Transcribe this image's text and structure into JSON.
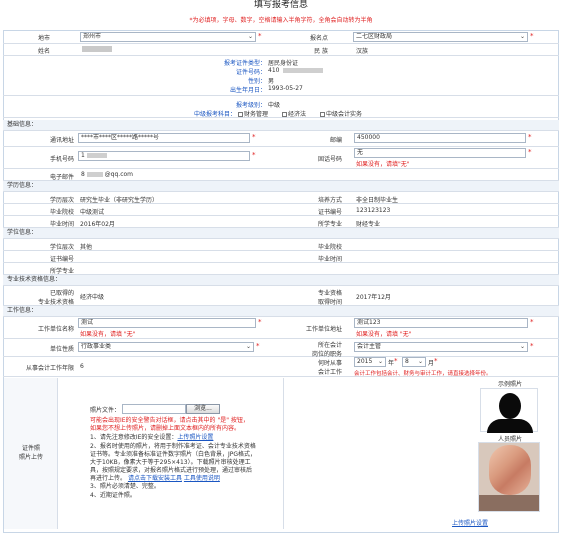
{
  "page_title": "填写报考信息",
  "notice": "*为必填项，字母、数字，空格请输入半角字符，全角会自动转为半角",
  "top": {
    "region_label": "地市",
    "region_value": "郑州市",
    "site_label": "报名点",
    "site_value": "二七区财政局",
    "name_label": "姓名",
    "nation_label": "民 族",
    "nation_value": "汉族"
  },
  "identity": {
    "idtype_label": "报考证件类型：",
    "idtype_value": "居民身份证",
    "idno_label": "证件号码：",
    "idno_value": "410",
    "gender_label": "性别：",
    "gender_value": "男",
    "birth_label": "出生年月日：",
    "birth_value": "1993-05-27"
  },
  "exam": {
    "level_label": "报考级别：",
    "level_value": "中级",
    "subject_label": "中级报考科目：",
    "subjects": [
      "财务管理",
      "经济法",
      "中级会计实务"
    ]
  },
  "basic": {
    "section": "基础信息：",
    "address_label": "通讯地址",
    "address_value": "****市****区*****路*****号",
    "zip_label": "邮编",
    "zip_value": "450000",
    "mobile_label": "手机号码",
    "mobile_value": "1",
    "phone_label": "固话号码",
    "phone_value": "无",
    "phone_hint": "如果没有，请填\"无\"",
    "email_label": "电子邮件",
    "email_value": "8",
    "email_suffix": "@qq.com"
  },
  "education": {
    "section": "学历信息：",
    "level_label": "学历层次",
    "level_value": "研究生毕业（非研究生学历）",
    "mode_label": "培养方式",
    "mode_value": "非全日制毕业生",
    "school_label": "毕业院校",
    "school_value": "中级测试",
    "cert_label": "证书编号",
    "cert_value": "123123123",
    "time_label": "毕业时间",
    "time_value": "2016年02月",
    "major_label": "所学专业",
    "major_value": "财经专业"
  },
  "degree": {
    "section": "学位信息：",
    "level_label": "学位层次",
    "level_value": "其他",
    "school_label": "毕业院校",
    "cert_label": "证书编号",
    "time_label": "毕业时间",
    "major_label": "所学专业"
  },
  "prof": {
    "section": "专业技术资格信息：",
    "got_label_1": "已取得的",
    "got_label_2": "专业技术资格",
    "got_value": "经济中级",
    "when_label_1": "专业资格",
    "when_label_2": "取得时间",
    "when_value": "2017年12月"
  },
  "work": {
    "section": "工作信息：",
    "unit_label": "工作单位名称",
    "unit_value": "测试",
    "unit_hint": "如果没有，请填 \"无\"",
    "addr_label": "工作单位地址",
    "addr_value": "测试123",
    "addr_hint": "如果没有，请填 \"无\"",
    "nature_label": "单位性质",
    "nature_value": "行政事业类",
    "post_label_1": "所在会计",
    "post_label_2": "岗位的职务",
    "post_value": "会计主管",
    "years_label": "从事会计工作年限",
    "years_value": "6",
    "start_label_1": "何时从事",
    "start_label_2": "会计工作",
    "start_year": "2015",
    "start_month": "8",
    "year_unit": "年",
    "month_unit": "月",
    "start_hint": "会计工作包括会计、财务与审计工作，请直接选择年份。"
  },
  "photo": {
    "section_label_1": "证件照",
    "section_label_2": "照片上传",
    "file_label": "照片文件：",
    "browse_label": "浏览...",
    "warn_1": "可能会出现IE的安全警告对话框，请点击其中的 \"是\" 按钮，",
    "warn_2": "如果您不想上传照片，请删掉上面文本框内的所有内容。",
    "tip_1": "1、请先注意修改IE的安全设置：",
    "tip_1_link": "上传照片设置",
    "tip_2_a": "2、报名时使用的照片，将用于制作准考证、会计专业技术资格",
    "tip_2_b": "证书等。专业须准备标准证件数字照片（白色背景，JPG格式，",
    "tip_2_c": "大于10KB，像素大于等于295×413）。下载照片审核处理工",
    "tip_2_d": "具，按照规定要求，对报名照片格式进行预处理，通过审核后",
    "tip_2_e": "再进行上传。",
    "tip_2_link_a": "请点击下载安装工具",
    "tip_2_link_b": "工具使用说明",
    "tip_3": "3、照片必须清楚、完整。",
    "tip_4": "4、近期证件照。",
    "sample_label": "示例照片",
    "photo_label": "人员照片",
    "upload_link": "上传照片设置"
  },
  "colors": {
    "required": "#e02020",
    "link": "#1a56c2",
    "section_bg": "#eef3f9"
  }
}
